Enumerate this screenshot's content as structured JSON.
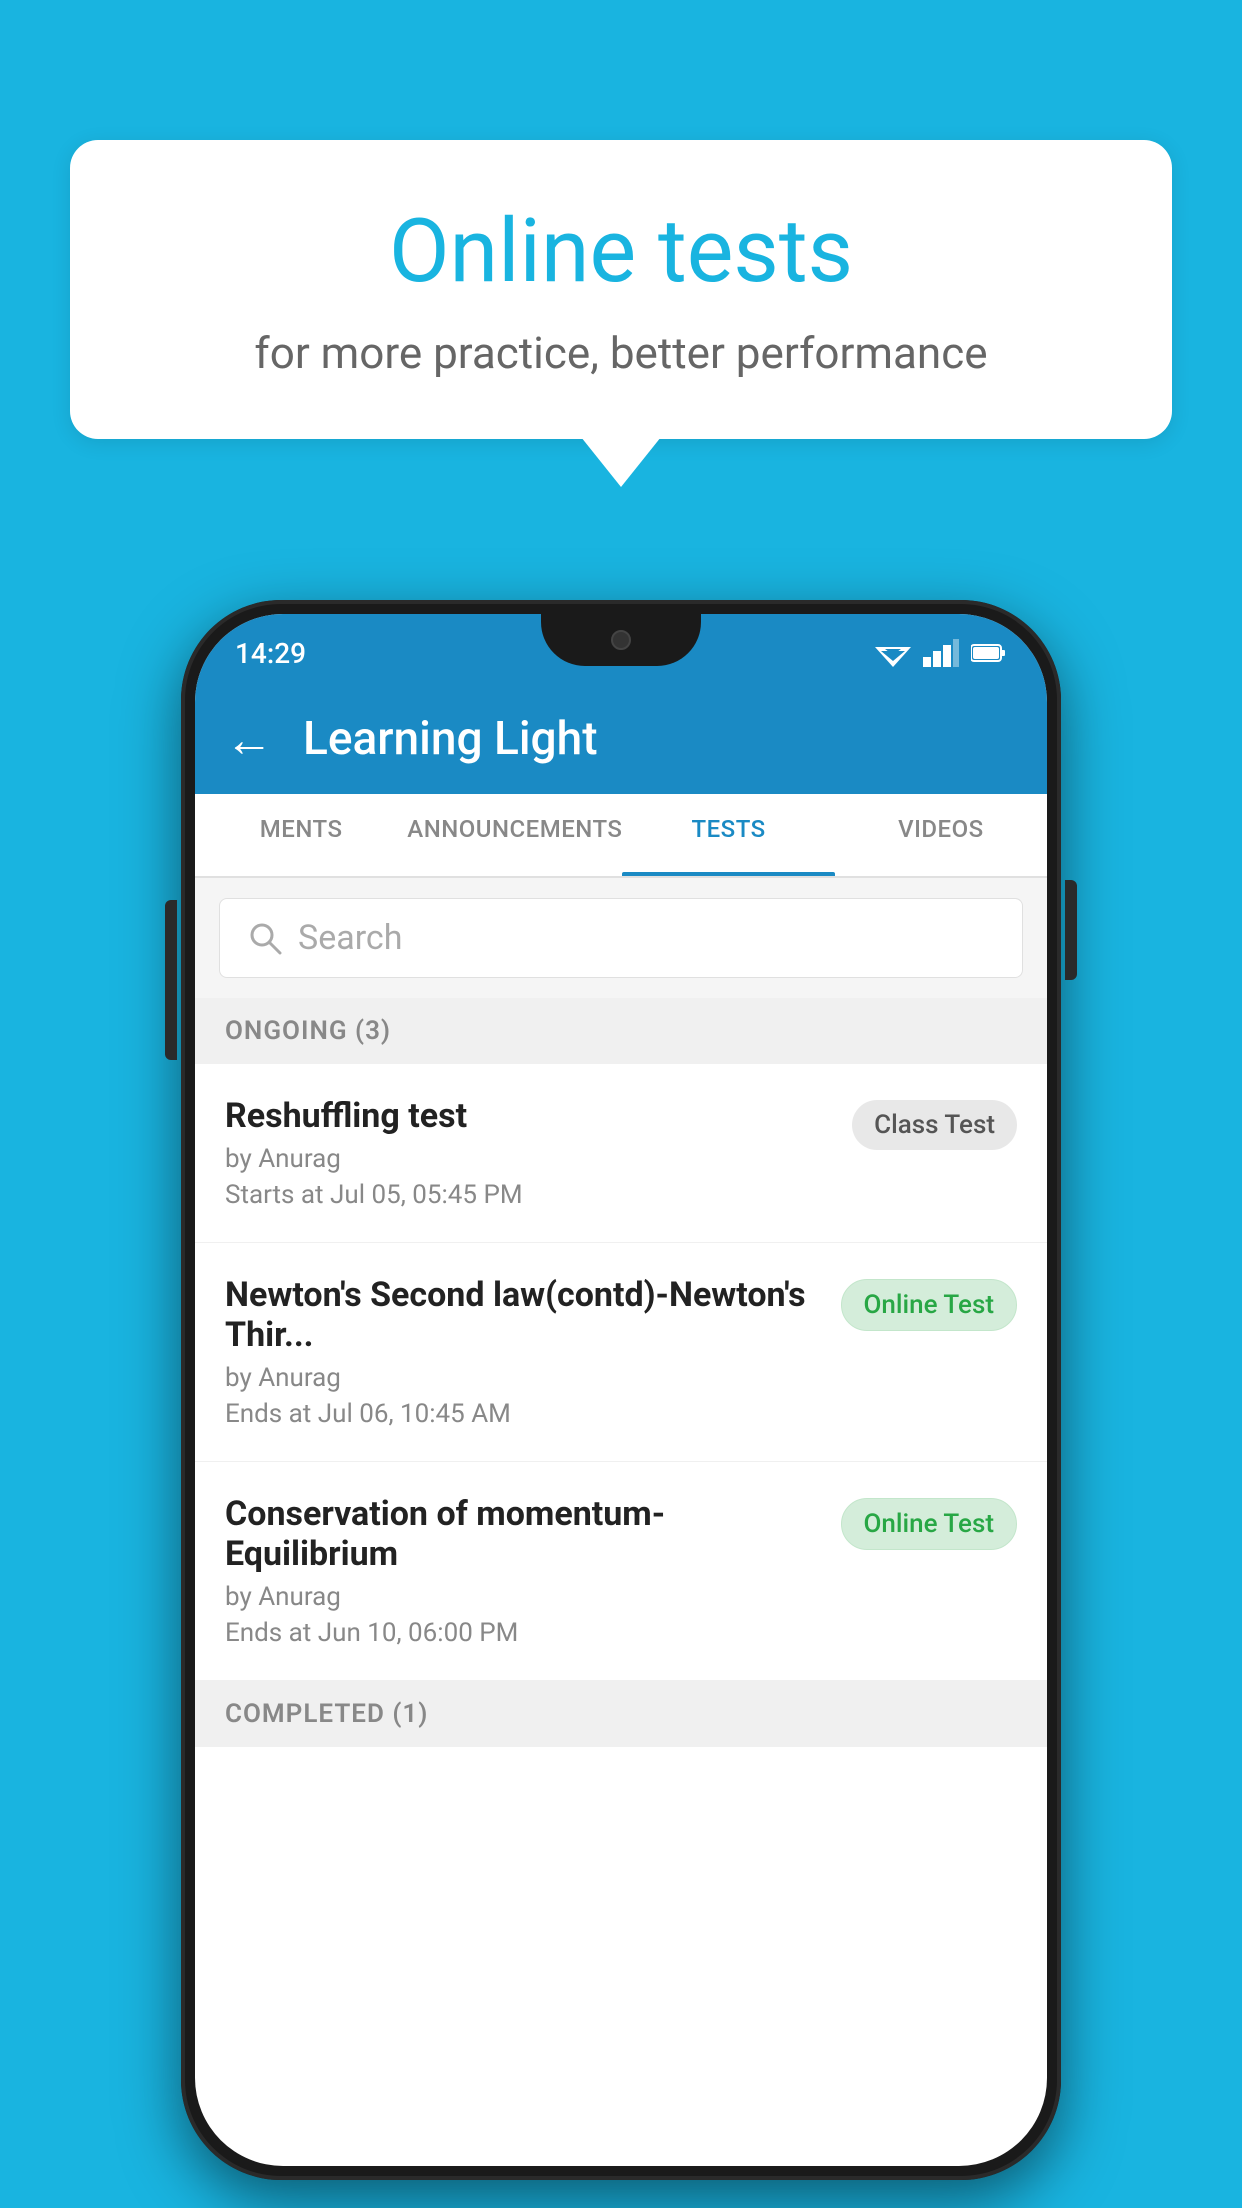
{
  "background_color": "#19b4e0",
  "speech_bubble": {
    "title": "Online tests",
    "subtitle": "for more practice, better performance"
  },
  "phone": {
    "status_bar": {
      "time": "14:29",
      "wifi": "▼",
      "signal": "▲",
      "battery": "▮"
    },
    "app_bar": {
      "title": "Learning Light",
      "back_label": "←"
    },
    "tabs": [
      {
        "label": "MENTS",
        "active": false
      },
      {
        "label": "ANNOUNCEMENTS",
        "active": false
      },
      {
        "label": "TESTS",
        "active": true
      },
      {
        "label": "VIDEOS",
        "active": false
      }
    ],
    "search": {
      "placeholder": "Search"
    },
    "sections": [
      {
        "title": "ONGOING (3)",
        "items": [
          {
            "name": "Reshuffling test",
            "author": "by Anurag",
            "date_label": "Starts at",
            "date": "Jul 05, 05:45 PM",
            "badge": "Class Test",
            "badge_type": "class"
          },
          {
            "name": "Newton's Second law(contd)-Newton's Thir...",
            "author": "by Anurag",
            "date_label": "Ends at",
            "date": "Jul 06, 10:45 AM",
            "badge": "Online Test",
            "badge_type": "online"
          },
          {
            "name": "Conservation of momentum-Equilibrium",
            "author": "by Anurag",
            "date_label": "Ends at",
            "date": "Jun 10, 06:00 PM",
            "badge": "Online Test",
            "badge_type": "online"
          }
        ]
      },
      {
        "title": "COMPLETED (1)",
        "items": []
      }
    ]
  }
}
